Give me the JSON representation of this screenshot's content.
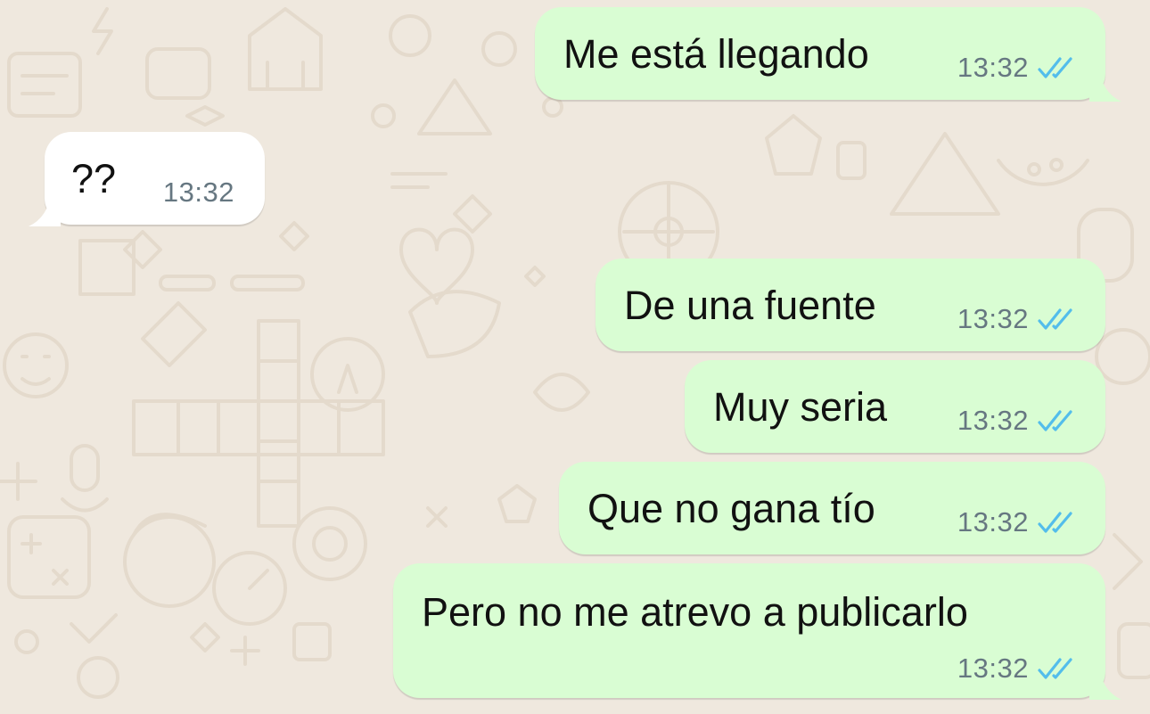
{
  "theme": {
    "background": "#efe8de",
    "outgoing_bubble": "#d9fdd3",
    "incoming_bubble": "#ffffff",
    "read_ticks": "#53bdeb",
    "timestamp": "#667781"
  },
  "messages": [
    {
      "direction": "outgoing",
      "text": "Me está llegando",
      "time": "13:32",
      "status": "read-ticks-icon"
    },
    {
      "direction": "incoming",
      "text": "??",
      "time": "13:32"
    },
    {
      "direction": "outgoing",
      "text": "De una fuente",
      "time": "13:32",
      "status": "read-ticks-icon"
    },
    {
      "direction": "outgoing",
      "text": "Muy seria",
      "time": "13:32",
      "status": "read-ticks-icon"
    },
    {
      "direction": "outgoing",
      "text": "Que no gana tío",
      "time": "13:32",
      "status": "read-ticks-icon"
    },
    {
      "direction": "outgoing",
      "text": "Pero no me atrevo a publicarlo",
      "time": "13:32",
      "status": "read-ticks-icon"
    }
  ]
}
